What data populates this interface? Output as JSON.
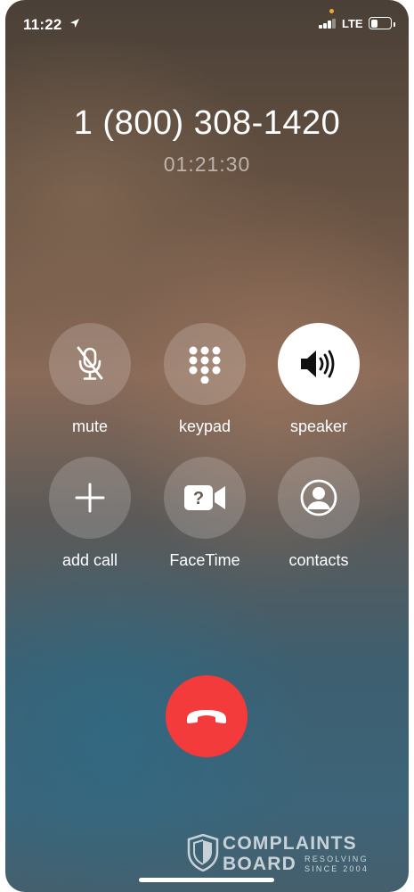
{
  "status_bar": {
    "time": "11:22",
    "network": "LTE",
    "battery_level": 0.35,
    "signal_bars": 3
  },
  "call": {
    "number": "1 (800) 308-1420",
    "duration": "01:21:30"
  },
  "controls": {
    "mute": "mute",
    "keypad": "keypad",
    "speaker": "speaker",
    "add_call": "add call",
    "facetime": "FaceTime",
    "contacts": "contacts"
  },
  "colors": {
    "end_call": "#f23b3a",
    "active_button": "#ffffff",
    "location_dot": "#f2a33a"
  },
  "watermark": {
    "title": "COMPLAINTS",
    "line2": "BOARD",
    "tag1": "RESOLVING",
    "tag2": "SINCE 2004"
  }
}
